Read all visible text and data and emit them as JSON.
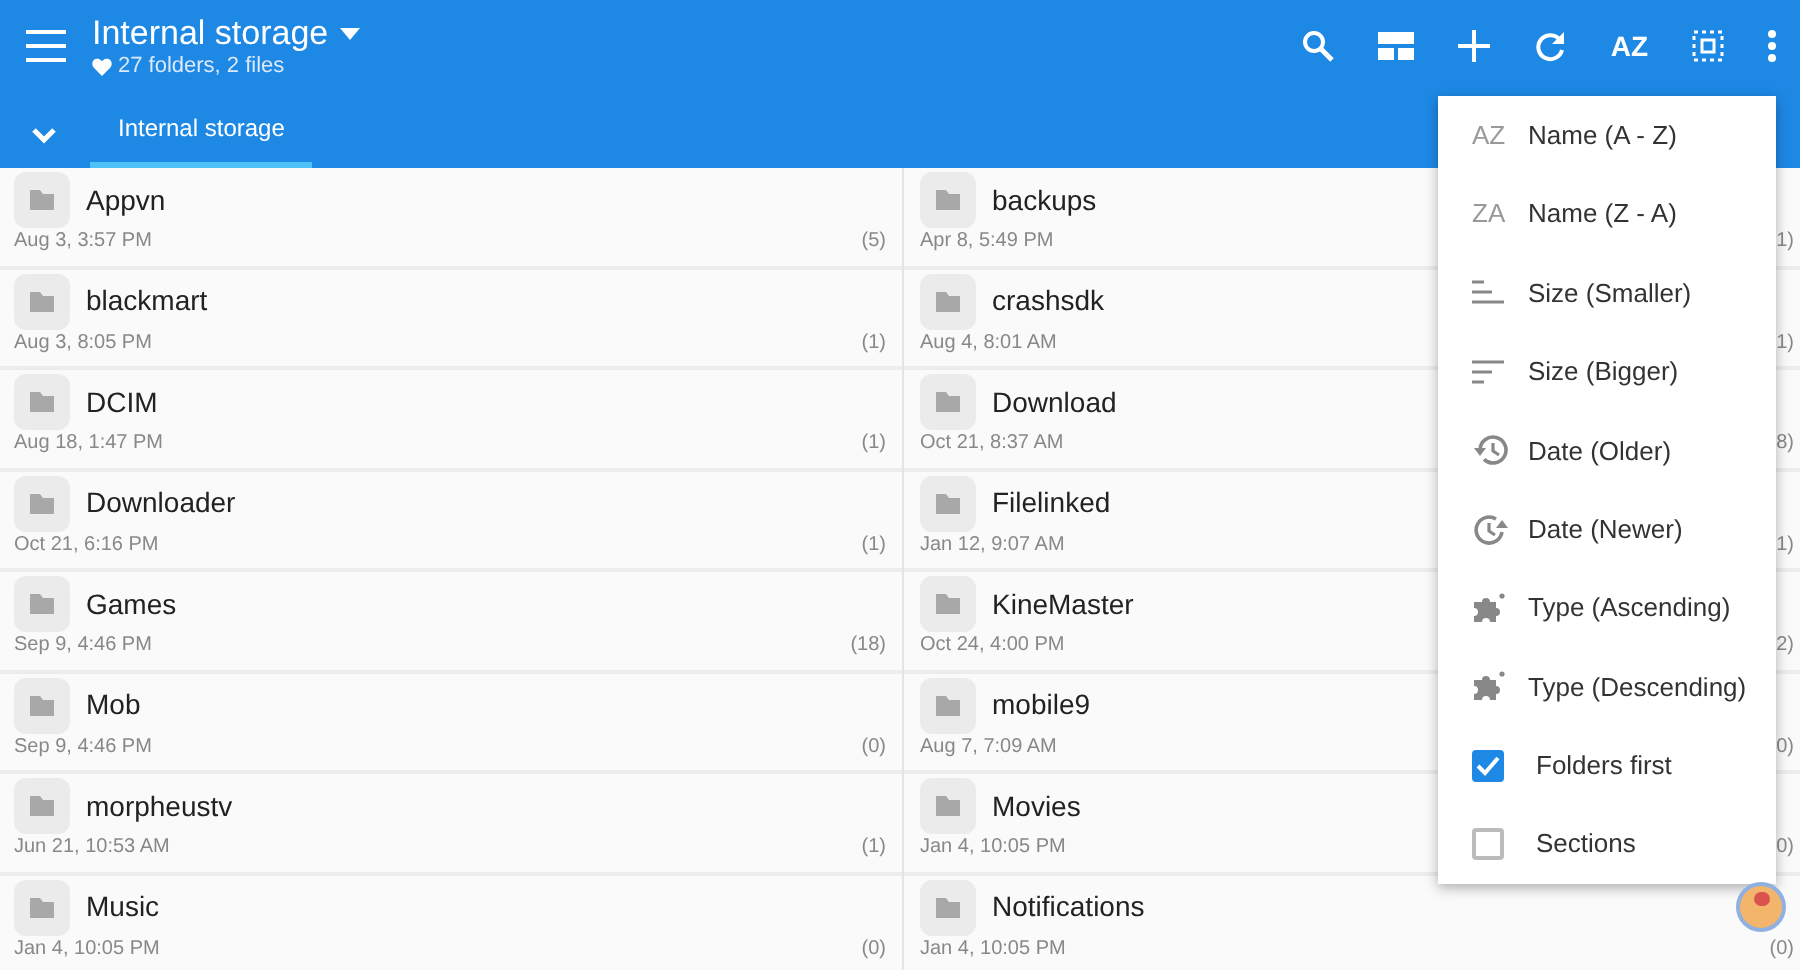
{
  "app_bar": {
    "title": "Internal storage",
    "subtitle": "27 folders, 2 files",
    "sort_label": "AZ"
  },
  "tabs": [
    {
      "label": "Internal storage",
      "selected": true
    }
  ],
  "columns": [
    {
      "rows": [
        {
          "name": "Appvn",
          "date": "Aug 3, 3:57 PM",
          "count": "(5)"
        },
        {
          "name": "blackmart",
          "date": "Aug 3, 8:05 PM",
          "count": "(1)"
        },
        {
          "name": "DCIM",
          "date": "Aug 18, 1:47 PM",
          "count": "(1)"
        },
        {
          "name": "Downloader",
          "date": "Oct 21, 6:16 PM",
          "count": "(1)"
        },
        {
          "name": "Games",
          "date": "Sep 9, 4:46 PM",
          "count": "(18)"
        },
        {
          "name": "Mob",
          "date": "Sep 9, 4:46 PM",
          "count": "(0)"
        },
        {
          "name": "morpheustv",
          "date": "Jun 21, 10:53 AM",
          "count": "(1)"
        },
        {
          "name": "Music",
          "date": "Jan 4, 10:05 PM",
          "count": "(0)"
        }
      ]
    },
    {
      "rows": [
        {
          "name": "backups",
          "date": "Apr 8, 5:49 PM",
          "count": "1)"
        },
        {
          "name": "crashsdk",
          "date": "Aug 4, 8:01 AM",
          "count": "1)"
        },
        {
          "name": "Download",
          "date": "Oct 21, 8:37 AM",
          "count": "8)"
        },
        {
          "name": "Filelinked",
          "date": "Jan 12, 9:07 AM",
          "count": "1)"
        },
        {
          "name": "KineMaster",
          "date": "Oct 24, 4:00 PM",
          "count": "2)"
        },
        {
          "name": "mobile9",
          "date": "Aug 7, 7:09 AM",
          "count": "0)"
        },
        {
          "name": "Movies",
          "date": "Jan 4, 10:05 PM",
          "count": "0)"
        },
        {
          "name": "Notifications",
          "date": "Jan 4, 10:05 PM",
          "count": "(0)"
        }
      ]
    }
  ],
  "sort_menu": {
    "items": [
      {
        "kind": "letters",
        "letters": "AZ",
        "label": "Name (A - Z)"
      },
      {
        "kind": "letters",
        "letters": "ZA",
        "label": "Name (Z - A)"
      },
      {
        "kind": "short-lines",
        "label": "Size (Smaller)"
      },
      {
        "kind": "long-lines",
        "label": "Size (Bigger)"
      },
      {
        "kind": "history",
        "label": "Date (Older)"
      },
      {
        "kind": "clock",
        "label": "Date (Newer)"
      },
      {
        "kind": "puzzle",
        "label": "Type (Ascending)"
      },
      {
        "kind": "puzzle",
        "label": "Type (Descending)"
      },
      {
        "kind": "checkbox",
        "label": "Folders first",
        "checked": true
      },
      {
        "kind": "checkbox",
        "label": "Sections",
        "checked": false
      }
    ]
  }
}
